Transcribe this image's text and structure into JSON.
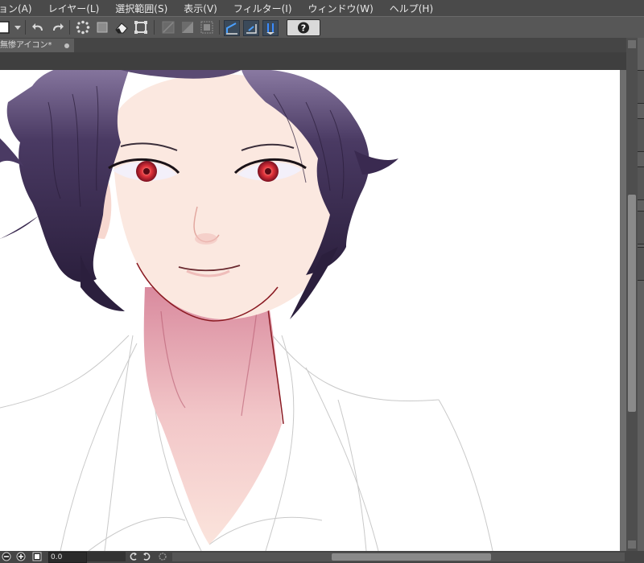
{
  "menu": [
    {
      "label": "ョン(A)"
    },
    {
      "label": "レイヤー(L)"
    },
    {
      "label": "選択範囲(S)"
    },
    {
      "label": "表示(V)"
    },
    {
      "label": "フィルター(I)"
    },
    {
      "label": "ウィンドウ(W)"
    },
    {
      "label": "ヘルプ(H)"
    }
  ],
  "toolbar": {
    "help_label": "?",
    "icons": [
      "color-swatch-icon",
      "dropdown-arrow-icon",
      "undo-icon",
      "redo-icon",
      "clear-selection-icon",
      "fill-selection-icon",
      "eraser-icon",
      "transform-icon",
      "snap-off-icon",
      "snap-grid-icon",
      "snap-frame-icon",
      "ruler-snap-icon",
      "special-ruler-icon",
      "guide-snap-icon",
      "help-icon"
    ]
  },
  "document_tab": {
    "title": "無惨アイコン*"
  },
  "statusbar": {
    "zoom": "0.0"
  },
  "colors": {
    "menubar_bg": "#4a4a4a",
    "toolbar_bg": "#575757",
    "canvas_bg": "#ffffff",
    "hair": "#3d2c52",
    "skin": "#fbe7df",
    "eye": "#e0313a"
  }
}
